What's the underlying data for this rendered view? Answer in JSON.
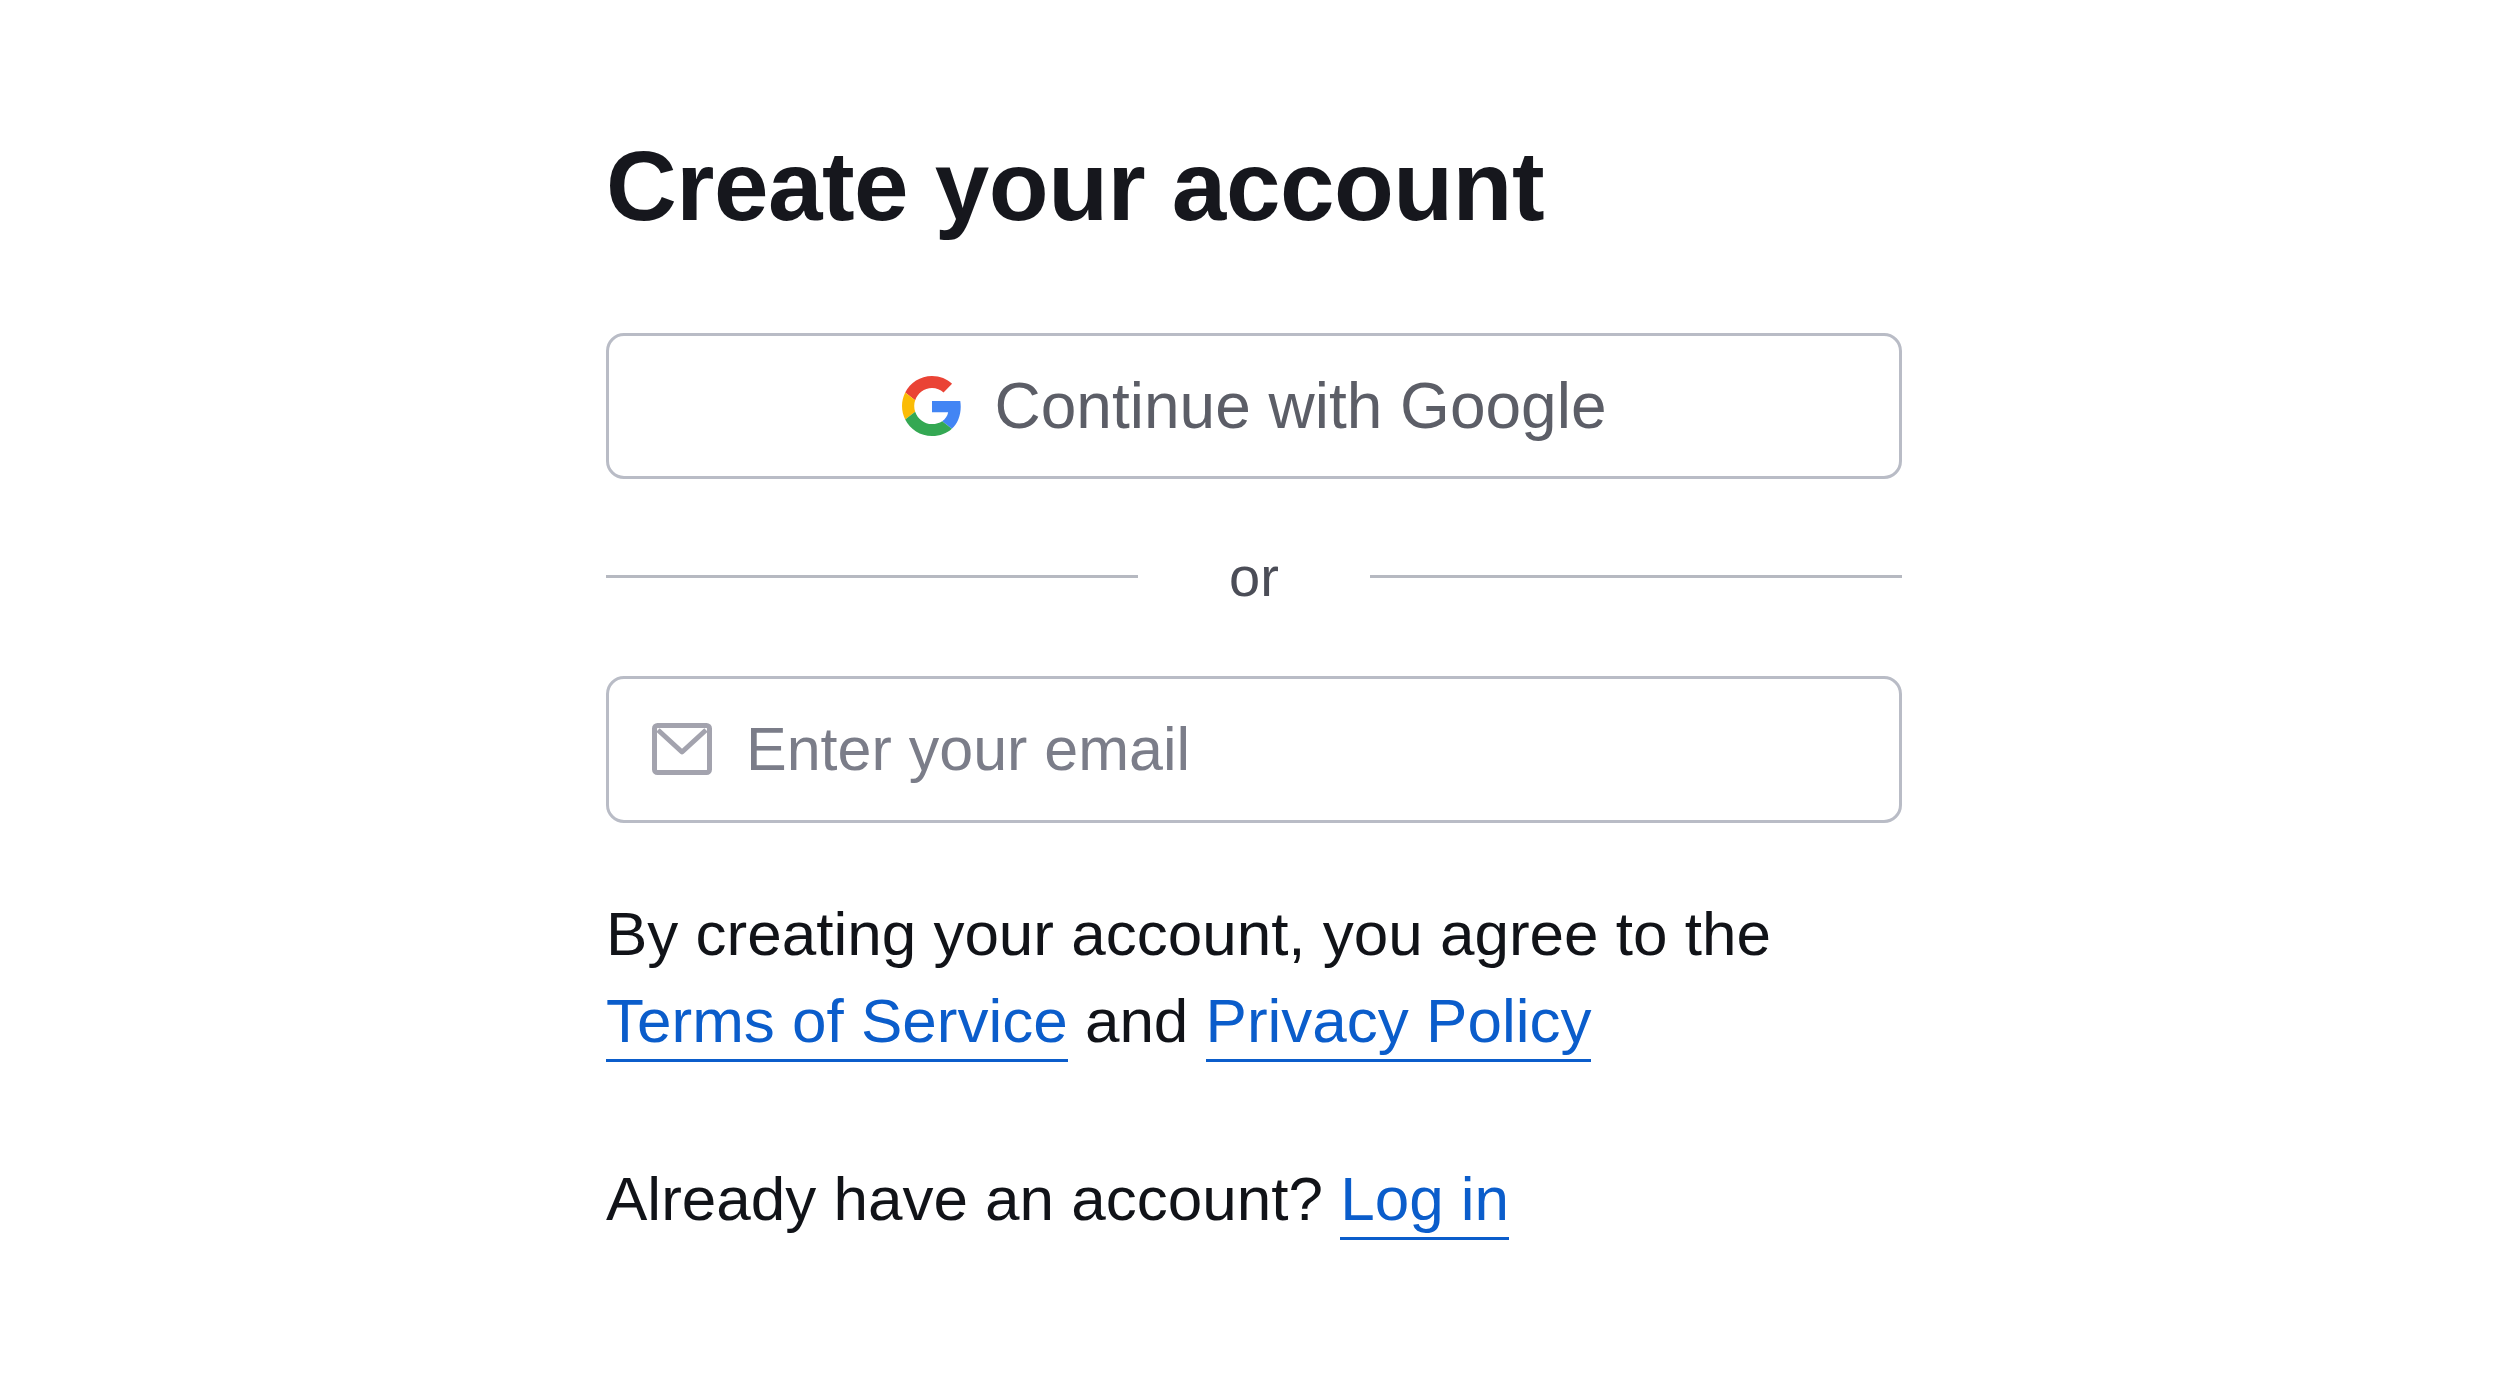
{
  "heading": "Create your account",
  "google_button": {
    "label": "Continue with Google"
  },
  "divider": {
    "label": "or"
  },
  "email_field": {
    "placeholder": "Enter your email"
  },
  "terms": [
    {
      "kind": "text",
      "text": "By creating your account, you agree to the"
    },
    {
      "kind": "link",
      "text": "Terms of Service"
    },
    {
      "kind": "text",
      "text": "and"
    },
    {
      "kind": "link",
      "text": "Privacy Policy"
    }
  ],
  "login_prompt": [
    {
      "kind": "text",
      "text": "Already have an account?"
    },
    {
      "kind": "link",
      "text": "Log in"
    }
  ]
}
